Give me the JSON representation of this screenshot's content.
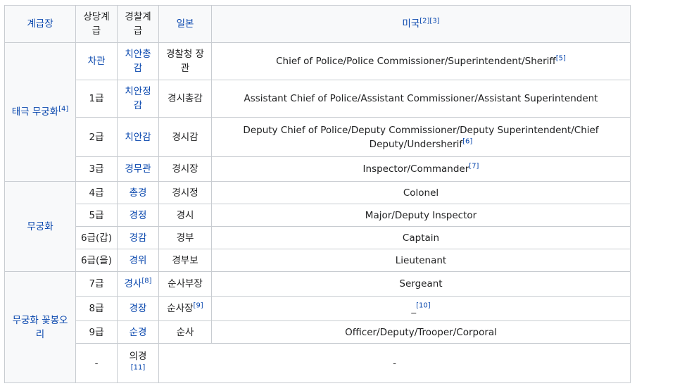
{
  "headers": {
    "grade": "계급장",
    "equiv": "상당계급",
    "police": "경찰계급",
    "japan": "일본",
    "usa": "미국",
    "usa_refs": "[2][3]"
  },
  "groups": [
    {
      "label": "태극 무궁화",
      "ref": "[4]"
    },
    {
      "label": "무궁화",
      "ref": ""
    },
    {
      "label": "무궁화 꽃봉오리",
      "ref": ""
    }
  ],
  "rows": [
    {
      "equiv": "차관",
      "equiv_link": true,
      "police": "치안총감",
      "police_ref": "",
      "japan": "경찰청 장관",
      "japan_ref": "",
      "usa": "Chief of Police/Police Commissioner/Superintendent/Sheriff",
      "usa_ref": "[5]"
    },
    {
      "equiv": "1급",
      "equiv_link": false,
      "police": "치안정감",
      "police_ref": "",
      "japan": "경시총감",
      "japan_ref": "",
      "usa": "Assistant Chief of Police/Assistant Commissioner/Assistant Superintendent",
      "usa_ref": ""
    },
    {
      "equiv": "2급",
      "equiv_link": false,
      "police": "치안감",
      "police_ref": "",
      "japan": "경시감",
      "japan_ref": "",
      "usa": "Deputy Chief of Police/Deputy Commissioner/Deputy Superintendent/Chief Deputy/Undersherif",
      "usa_ref": "[6]"
    },
    {
      "equiv": "3급",
      "equiv_link": false,
      "police": "경무관",
      "police_ref": "",
      "japan": "경시장",
      "japan_ref": "",
      "usa": "Inspector/Commander",
      "usa_ref": "[7]"
    },
    {
      "equiv": "4급",
      "equiv_link": false,
      "police": "총경",
      "police_ref": "",
      "japan": "경시정",
      "japan_ref": "",
      "usa": "Colonel",
      "usa_ref": ""
    },
    {
      "equiv": "5급",
      "equiv_link": false,
      "police": "경정",
      "police_ref": "",
      "japan": "경시",
      "japan_ref": "",
      "usa": "Major/Deputy Inspector",
      "usa_ref": ""
    },
    {
      "equiv": "6급(갑)",
      "equiv_link": false,
      "police": "경감",
      "police_ref": "",
      "japan": "경부",
      "japan_ref": "",
      "usa": "Captain",
      "usa_ref": ""
    },
    {
      "equiv": "6급(을)",
      "equiv_link": false,
      "police": "경위",
      "police_ref": "",
      "japan": "경부보",
      "japan_ref": "",
      "usa": "Lieutenant",
      "usa_ref": ""
    },
    {
      "equiv": "7급",
      "equiv_link": false,
      "police": "경사",
      "police_ref": "[8]",
      "japan": "순사부장",
      "japan_ref": "",
      "usa": "Sergeant",
      "usa_ref": ""
    },
    {
      "equiv": "8급",
      "equiv_link": false,
      "police": "경장",
      "police_ref": "",
      "japan": "순사장",
      "japan_ref": "[9]",
      "usa": "_",
      "usa_ref": "[10]"
    },
    {
      "equiv": "9급",
      "equiv_link": false,
      "police": "순경",
      "police_ref": "",
      "japan": "순사",
      "japan_ref": "",
      "usa": "Officer/Deputy/Trooper/Corporal",
      "usa_ref": ""
    }
  ],
  "last_row": {
    "equiv": "-",
    "police": "의경",
    "police_ref": "[11]",
    "usa": "-"
  }
}
